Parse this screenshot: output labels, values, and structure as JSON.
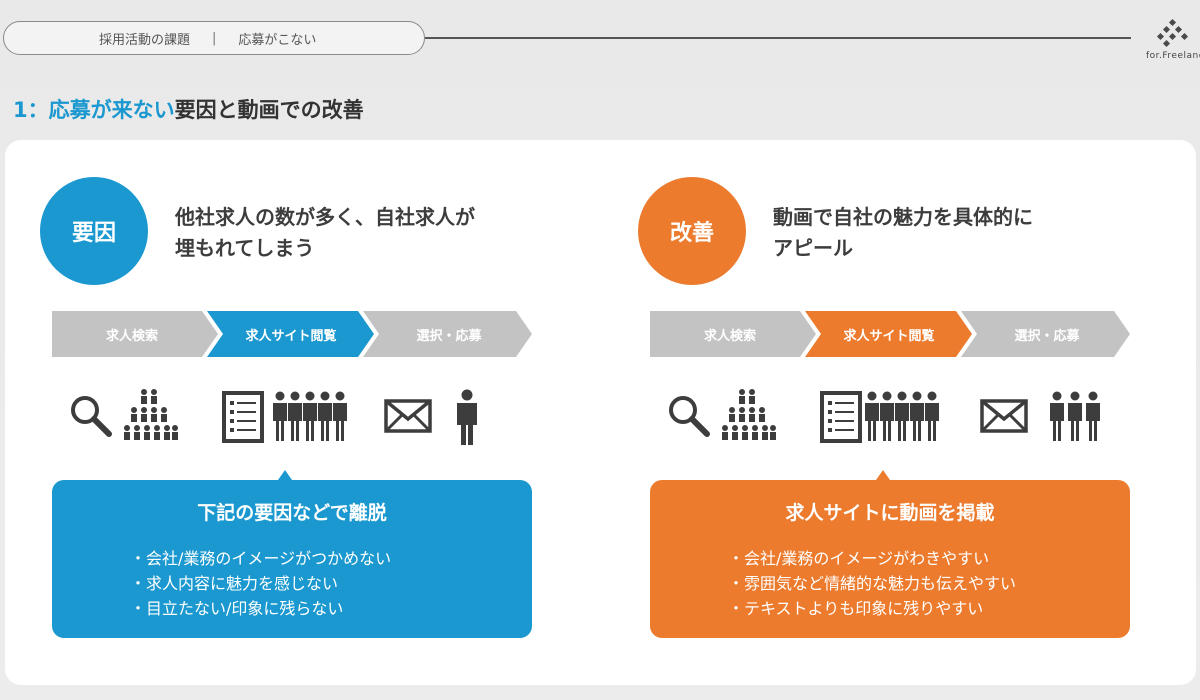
{
  "header": {
    "breadcrumb_part1": "採用活動の課題",
    "breadcrumb_sep": "|",
    "breadcrumb_part2": "応募がこない",
    "logo_text": "for.Freelance"
  },
  "title": {
    "highlight": "1：応募が来ない",
    "rest": "要因と動画での改善"
  },
  "colors": {
    "blue": "#1a98cf",
    "orange": "#ec7b2e",
    "grey_step": "#c3c3c3",
    "icon": "#3d3d3d"
  },
  "left": {
    "badge": "要因",
    "headline_line1": "他社求人の数が多く、自社求人が",
    "headline_line2": "埋もれてしまう",
    "steps": [
      "求人検索",
      "求人サイト閲覧",
      "選択・応募"
    ],
    "active_step": 1,
    "icons": [
      "search-icon",
      "crowd-icon",
      "document-icon",
      "people-group-icon",
      "envelope-icon",
      "person-icon"
    ],
    "box_title": "下記の要因などで離脱",
    "box_items": [
      "・会社/業務のイメージがつかめない",
      "・求人内容に魅力を感じない",
      "・目立たない/印象に残らない"
    ]
  },
  "right": {
    "badge": "改善",
    "headline_line1": "動画で自社の魅力を具体的に",
    "headline_line2": "アピール",
    "steps": [
      "求人検索",
      "求人サイト閲覧",
      "選択・応募"
    ],
    "active_step": 1,
    "icons": [
      "search-icon",
      "crowd-icon",
      "document-icon",
      "people-group-icon",
      "envelope-icon",
      "people-group-small-icon"
    ],
    "box_title": "求人サイトに動画を掲載",
    "box_items": [
      "・会社/業務のイメージがわきやすい",
      "・雰囲気など情緒的な魅力も伝えやすい",
      "・テキストよりも印象に残りやすい"
    ]
  }
}
